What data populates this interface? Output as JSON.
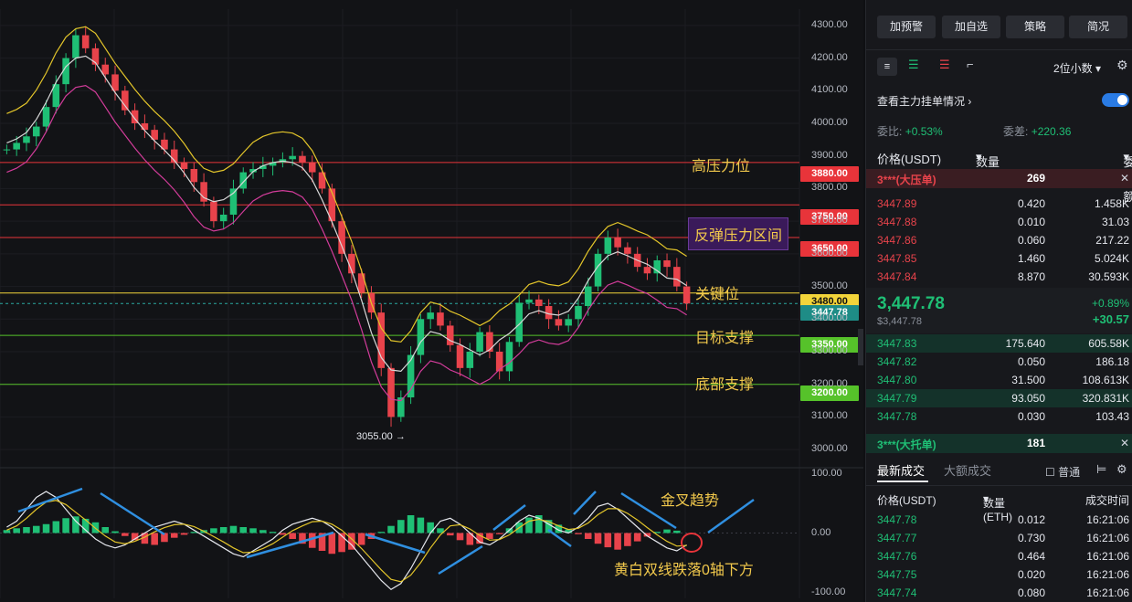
{
  "chart_data": {
    "type": "candlestick",
    "price_axis": {
      "ticks": [
        "4300.00",
        "4200.00",
        "4100.00",
        "4000.00",
        "3900.00",
        "3800.00",
        "3700.00",
        "3600.00",
        "3500.00",
        "3400.00",
        "3300.00",
        "3200.00",
        "3100.00",
        "3000.00"
      ],
      "ylim": [
        2950,
        4350
      ]
    },
    "macd_axis": {
      "ticks": [
        "100.00",
        "0.00",
        "-100.00"
      ],
      "ylim": [
        -110,
        110
      ]
    },
    "close_path": [
      3920,
      3940,
      3960,
      3990,
      4050,
      4120,
      4200,
      4270,
      4230,
      4180,
      4150,
      4100,
      4040,
      4000,
      3980,
      3950,
      3920,
      3880,
      3860,
      3820,
      3760,
      3700,
      3720,
      3800,
      3850,
      3860,
      3870,
      3880,
      3890,
      3900,
      3880,
      3850,
      3800,
      3700,
      3600,
      3540,
      3480,
      3420,
      3250,
      3100,
      3160,
      3290,
      3400,
      3420,
      3380,
      3320,
      3250,
      3300,
      3360,
      3300,
      3240,
      3330,
      3450,
      3460,
      3440,
      3400,
      3380,
      3400,
      3440,
      3500,
      3600,
      3650,
      3620,
      3600,
      3560,
      3540,
      3580,
      3560,
      3500,
      3447.78
    ],
    "macd_hist": [
      5,
      8,
      10,
      12,
      15,
      20,
      25,
      28,
      24,
      18,
      10,
      3,
      -5,
      -12,
      -18,
      -20,
      -15,
      -8,
      -3,
      2,
      5,
      8,
      10,
      12,
      10,
      8,
      5,
      2,
      -3,
      -10,
      -18,
      -25,
      -30,
      -35,
      -32,
      -28,
      -20,
      -10,
      2,
      12,
      22,
      30,
      26,
      18,
      8,
      -4,
      -12,
      -20,
      -18,
      -10,
      -2,
      8,
      18,
      26,
      30,
      22,
      14,
      6,
      -2,
      -10,
      -18,
      -24,
      -28,
      -22,
      -14,
      -6,
      2,
      6,
      4,
      0
    ],
    "macd_dif": [
      10,
      20,
      40,
      60,
      70,
      60,
      40,
      20,
      5,
      -10,
      -20,
      -25,
      -20,
      -10,
      0,
      10,
      15,
      20,
      15,
      5,
      -5,
      -15,
      -25,
      -35,
      -40,
      -30,
      -20,
      -10,
      5,
      15,
      20,
      25,
      20,
      10,
      -5,
      -20,
      -40,
      -60,
      -80,
      -95,
      -85,
      -60,
      -30,
      0,
      20,
      25,
      15,
      0,
      -15,
      -20,
      -10,
      5,
      20,
      30,
      25,
      15,
      5,
      0,
      10,
      25,
      45,
      50,
      40,
      25,
      10,
      -5,
      -15,
      -25,
      -30,
      -20
    ],
    "macd_dea": [
      5,
      12,
      25,
      40,
      52,
      55,
      48,
      35,
      22,
      8,
      -5,
      -15,
      -18,
      -14,
      -7,
      2,
      9,
      14,
      15,
      11,
      3,
      -6,
      -15,
      -25,
      -33,
      -32,
      -26,
      -18,
      -7,
      4,
      12,
      19,
      20,
      15,
      5,
      -10,
      -26,
      -44,
      -62,
      -78,
      -82,
      -71,
      -50,
      -25,
      -3,
      12,
      14,
      7,
      -4,
      -12,
      -11,
      -3,
      9,
      20,
      23,
      19,
      12,
      6,
      8,
      17,
      31,
      41,
      41,
      33,
      22,
      9,
      -3,
      -14,
      -22,
      -21
    ],
    "lines": [
      {
        "label": "高压力位",
        "price_tag": "3880.00",
        "value": 3880,
        "color": "#e8343a"
      },
      {
        "label": "反弹压力区间",
        "price_tag": "3750.00",
        "value": 3750,
        "color": "#e8343a"
      },
      {
        "label": "",
        "price_tag": "3650.00",
        "value": 3650,
        "color": "#e8343a"
      },
      {
        "label": "关键位",
        "price_tag": "3480.00",
        "value": 3480,
        "color": "#f2d43a"
      },
      {
        "label": "目标支撑",
        "price_tag": "3350.00",
        "value": 3350,
        "color": "#56c22a"
      },
      {
        "label": "底部支撑",
        "price_tag": "3200.00",
        "value": 3200,
        "color": "#56c22a"
      }
    ],
    "current_price_tag": "3447.78",
    "low_marker": "3055.00 →",
    "macd_annotations": [
      "金叉趋势",
      "黄白双线跌落0轴下方"
    ]
  },
  "sidebar": {
    "header_buttons": [
      "加预警",
      "加自选",
      "策略",
      "简况"
    ],
    "decimals": "2位小数",
    "main_orders_label": "查看主力挂单情况",
    "ratio_label": "委比:",
    "ratio_value": "+0.53%",
    "diff_label": "委差:",
    "diff_value": "+220.36",
    "col_price": "价格(USDT)",
    "col_qty": "数量 (ETH)",
    "col_total": "委托额",
    "big_ask_label": "3***(大压单)",
    "big_ask_qty": "269",
    "asks": [
      {
        "price": "3447.89",
        "qty": "0.420",
        "total": "1.458K"
      },
      {
        "price": "3447.88",
        "qty": "0.010",
        "total": "31.03"
      },
      {
        "price": "3447.86",
        "qty": "0.060",
        "total": "217.22"
      },
      {
        "price": "3447.85",
        "qty": "1.460",
        "total": "5.024K"
      },
      {
        "price": "3447.84",
        "qty": "8.870",
        "total": "30.593K"
      }
    ],
    "last_price": "3,447.78",
    "last_price_sub": "$3,447.78",
    "change_pct": "+0.89%",
    "change_abs": "+30.57",
    "bids": [
      {
        "price": "3447.83",
        "qty": "175.640",
        "total": "605.58K"
      },
      {
        "price": "3447.82",
        "qty": "0.050",
        "total": "186.18"
      },
      {
        "price": "3447.80",
        "qty": "31.500",
        "total": "108.613K"
      },
      {
        "price": "3447.79",
        "qty": "93.050",
        "total": "320.831K"
      },
      {
        "price": "3447.78",
        "qty": "0.030",
        "total": "103.43"
      }
    ],
    "big_bid_label": "3***(大托单)",
    "big_bid_qty": "181",
    "tab_latest": "最新成交",
    "tab_large": "大额成交",
    "normal_label": "普通",
    "trades_col_price": "价格(USDT)",
    "trades_col_qty": "数量(ETH)",
    "trades_col_time": "成交时间",
    "trades": [
      {
        "price": "3447.78",
        "qty": "0.012",
        "time": "16:21:06"
      },
      {
        "price": "3447.77",
        "qty": "0.730",
        "time": "16:21:06"
      },
      {
        "price": "3447.76",
        "qty": "0.464",
        "time": "16:21:06"
      },
      {
        "price": "3447.75",
        "qty": "0.020",
        "time": "16:21:06"
      },
      {
        "price": "3447.74",
        "qty": "0.080",
        "time": "16:21:06"
      }
    ]
  }
}
